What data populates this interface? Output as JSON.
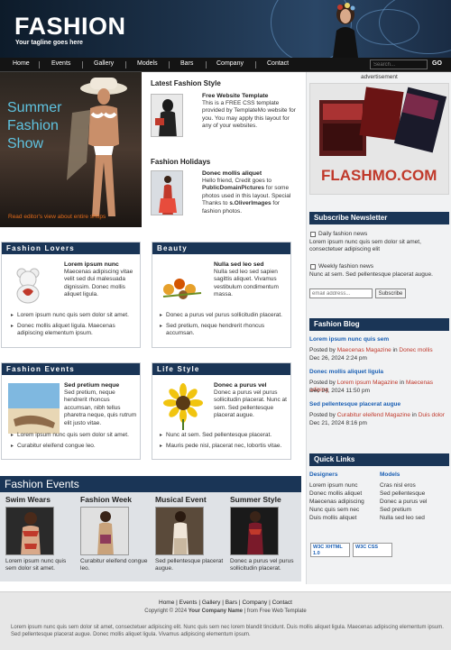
{
  "header": {
    "site_title": "FASHION",
    "tagline": "Your tagline goes here"
  },
  "nav": {
    "items": [
      "Home",
      "Events",
      "Gallery",
      "Models",
      "Bars",
      "Company",
      "Contact"
    ],
    "search_placeholder": "Search...",
    "go_label": "GO"
  },
  "featured": {
    "title_lines": [
      "Summer",
      "Fashion",
      "Show"
    ],
    "link": "Read editor's view about entire shops"
  },
  "latest": {
    "heading": "Latest Fashion Style",
    "item_title": "Free Website Template",
    "body": "This is a FREE CSS template provided by TemplateMo website for you. You may apply this layout for any of your websites."
  },
  "holidays": {
    "heading": "Fashion Holidays",
    "item_title": "Donec mollis aliquet",
    "body_parts": [
      "Hello friend, Credit goes to ",
      "PublicDomainPictures",
      " for some photos used in this layout. Special Thanks to ",
      "s.OliverImages",
      " for fashion photos."
    ]
  },
  "boxes": [
    {
      "title": "Fashion Lovers",
      "item_title": "Lorem ipsum nunc",
      "body": "Maecenas adipiscing vitae velit sed dui malesuada dignissim. Donec mollis aliquet ligula.",
      "bullets": [
        "Lorem ipsum nunc quis sem dolor sit amet.",
        "Donec mollis aliquet ligula. Maecenas adipiscing elementum ipsum."
      ]
    },
    {
      "title": "Beauty",
      "item_title": "Nulla sed leo sed",
      "body": "Nulla sed leo sed sapien sagittis aliquet. Vivamus vestibulum condimentum massa.",
      "bullets": [
        "Donec a purus vel purus sollicitudin placerat.",
        "Sed pretium, neque hendrerit rhoncus accumsan."
      ]
    },
    {
      "title": "Fashion Events",
      "item_title": "Sed pretium neque",
      "body": "Sed pretium, neque hendrerit rhoncus accumsan, nibh tellus pharetra neque, quis rutrum elit justo vitae.",
      "bullets": [
        "Lorem ipsum nunc quis sem dolor sit amet.",
        "Curabitur eleifend congue leo."
      ]
    },
    {
      "title": "Life Style",
      "item_title": "Donec a purus vel",
      "body": "Donec a purus vel purus sollicitudin placerat. Nunc at sem. Sed pellentesque placerat augue.",
      "bullets": [
        "Nunc at sem. Sed pellentesque placerat.",
        "Mauris pede nisl, placerat nec, lobortis vitae."
      ]
    }
  ],
  "bottom": {
    "title": "Fashion Events",
    "categories": [
      {
        "title": "Swim Wears",
        "text": "Lorem ipsum nunc quis sem dolor sit amet."
      },
      {
        "title": "Fashion Week",
        "text": "Curabitur eleifend congue leo."
      },
      {
        "title": "Musical Event",
        "text": "Sed pellentesque placerat augue."
      },
      {
        "title": "Summer Style",
        "text": "Donec a purus vel purus sollicitudin placerat."
      }
    ]
  },
  "sidebar": {
    "ad_label": "advertisement",
    "ad_brand": "FLASHMO.COM",
    "newsletter": {
      "title": "Subscribe Newsletter",
      "daily_label": "Daily fashion news",
      "daily_text": "Lorem ipsum nunc quis sem dolor sit amet, consectetuer adipiscing elit",
      "weekly_label": "Weekly fashion news",
      "weekly_text": "Nunc at sem. Sed pellentesque placerat augue.",
      "email_placeholder": "email address...",
      "subscribe_label": "Subscribe"
    },
    "blog": {
      "title": "Fashion Blog",
      "posts": [
        {
          "title": "Lorem ipsum nunc quis sem",
          "by": "Posted by ",
          "mag": "Maecenas Magazine",
          "in": " in ",
          "cat": "Donec mollis",
          "date": "Dec 26, 2024 2:24 pm"
        },
        {
          "title": "Donec mollis aliquet ligula",
          "by": "Posted by ",
          "mag": "Lorem ipsum Magazine",
          "in": " in ",
          "cat": "Maecenas adiping",
          "date": "Dec 24, 2024 11:50 pm"
        },
        {
          "title": "Sed pellentesque placerat augue",
          "by": "Posted by ",
          "mag": "Curabitur eleifend Magazine",
          "in": " in ",
          "cat": "Duis dolor",
          "date": "Dec 21, 2024 8:16 pm"
        }
      ]
    },
    "quicklinks": {
      "title": "Quick Links",
      "designers_heading": "Designers",
      "models_heading": "Models",
      "designers": [
        "Lorem ipsum nunc",
        "Donec mollis aliquet",
        "Maecenas adipiscing",
        "Nunc quis sem nec",
        "Duis mollis aliquet"
      ],
      "models": [
        "Cras nisl eros",
        "Sed pellentesque",
        "Donec a purus vel",
        "Sed pretium",
        "Nulla sed leo sed"
      ]
    },
    "badges": {
      "xhtml": "W3C XHTML 1.0",
      "css": "W3C CSS"
    }
  },
  "footer": {
    "links": [
      "Home",
      "Events",
      "Gallery",
      "Bars",
      "Company",
      "Contact"
    ],
    "copy_prefix": "Copyright © 2024 ",
    "company": "Your Company Name",
    "copy_suffix": " | from Free Web Template",
    "note": "Lorem ipsum nunc quis sem dolor sit amet, consectetuer adipiscing elit. Nunc quis sem nec lorem blandit tincidunt. Duis mollis aliquet ligula. Maecenas adipiscing elementum ipsum. Sed pellentesque placerat augue. Donec mollis aliquet ligula. Vivamus adipiscing elementum ipsum."
  },
  "colors": {
    "accent": "#1a3556",
    "link": "#1a5fb4",
    "highlight": "#c0392b",
    "featured_text": "#5fc3e0"
  }
}
